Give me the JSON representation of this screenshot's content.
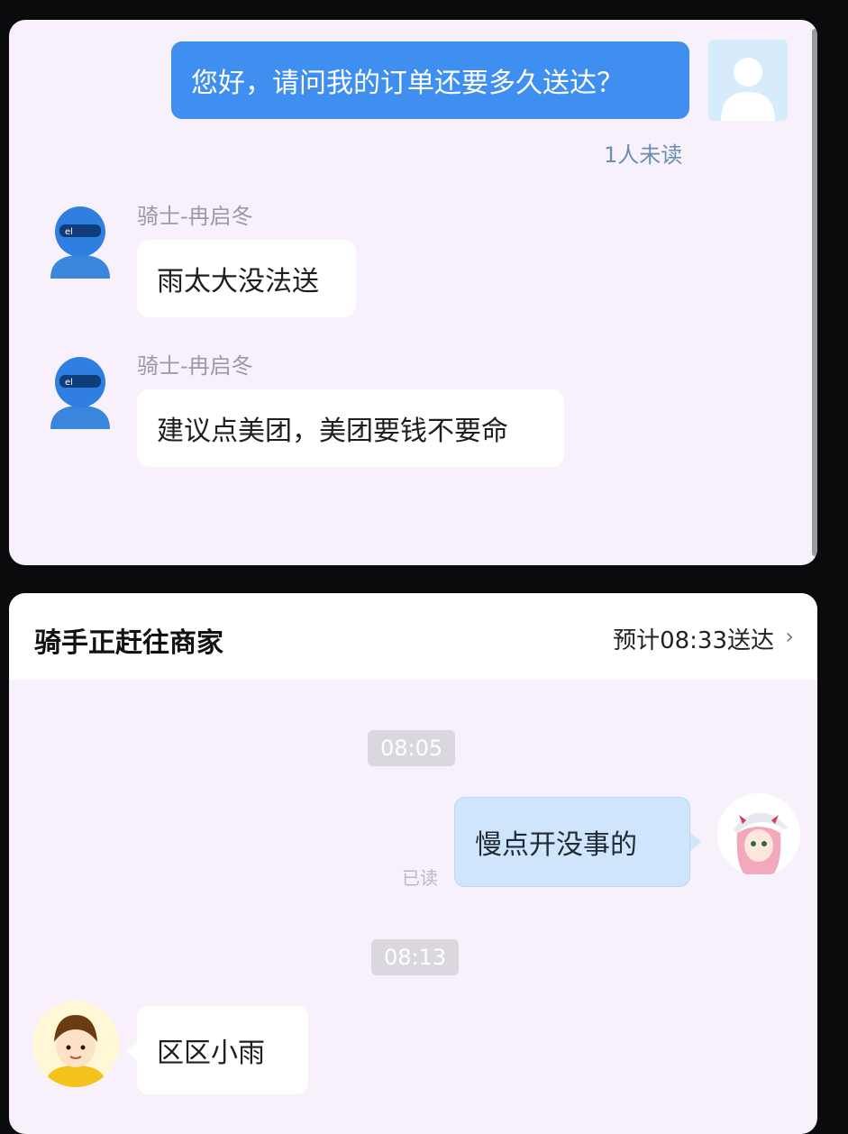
{
  "chat1": {
    "user_message": "您好，请问我的订单还要多久送达？",
    "unread_status": "1人未读",
    "rider_name_1": "骑士-冉启冬",
    "rider_message_1": "雨太大没法送",
    "rider_name_2": "骑士-冉启冬",
    "rider_message_2": "建议点美团，美团要钱不要命"
  },
  "chat2": {
    "header_title": "骑手正赶往商家",
    "header_eta": "预计08:33送达",
    "time_1": "08:05",
    "user_message": "慢点开没事的",
    "read_status": "已读",
    "time_2": "08:13",
    "rider_message": "区区小雨"
  },
  "icons": {
    "chevron": "chevron-right-icon"
  },
  "colors": {
    "blue_bubble": "#3f8ff0",
    "light_blue_bubble": "#cfe5fb",
    "background": "#f8f1fb"
  }
}
